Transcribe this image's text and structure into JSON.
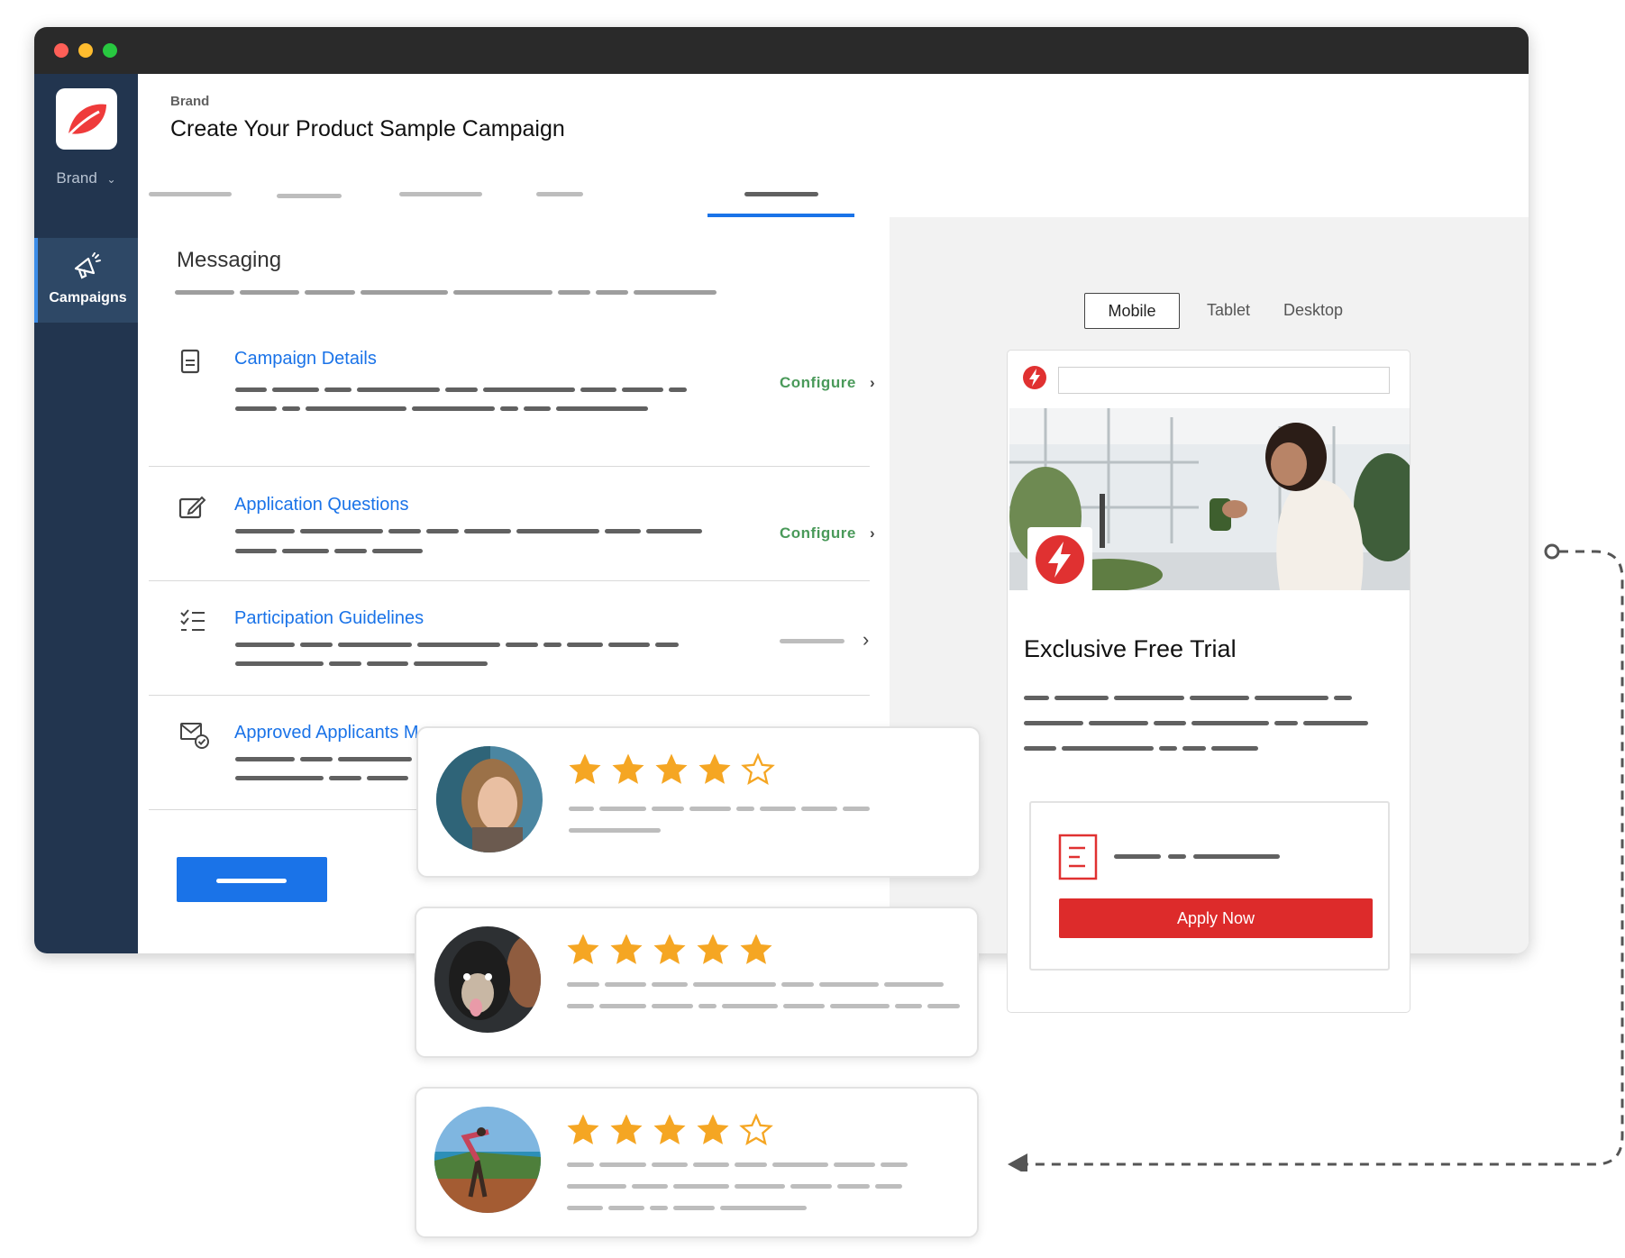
{
  "sidebar": {
    "brand_label": "Brand",
    "nav_items": [
      {
        "label": "Campaigns",
        "icon": "megaphone-icon",
        "active": true
      }
    ]
  },
  "header": {
    "breadcrumb": "Brand",
    "title": "Create Your Product Sample Campaign"
  },
  "messaging": {
    "title": "Messaging",
    "items": [
      {
        "label": "Campaign Details",
        "icon": "document-icon",
        "action": "Configure"
      },
      {
        "label": "Application Questions",
        "icon": "edit-icon",
        "action": "Configure"
      },
      {
        "label": "Participation Guidelines",
        "icon": "checklist-icon",
        "action": ""
      },
      {
        "label": "Approved Applicants Message",
        "icon": "mail-check-icon",
        "action": ""
      }
    ]
  },
  "preview": {
    "device_tabs": [
      "Mobile",
      "Tablet",
      "Desktop"
    ],
    "selected_tab": "Mobile",
    "offer_title": "Exclusive Free Trial",
    "apply_label": "Apply Now"
  },
  "reviews": [
    {
      "stars": 4,
      "max": 5
    },
    {
      "stars": 5,
      "max": 5
    },
    {
      "stars": 4,
      "max": 5
    }
  ],
  "colors": {
    "accent": "#1a73e8",
    "brand_red": "#dd2b2b",
    "sidebar": "#22354f",
    "star": "#f5a623",
    "configure": "#4a9a5a"
  }
}
